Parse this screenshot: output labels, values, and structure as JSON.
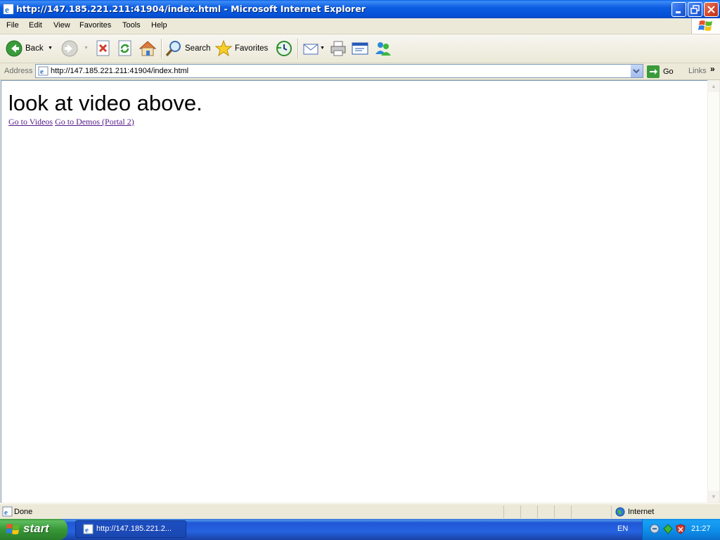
{
  "window": {
    "title": "http://147.185.221.211:41904/index.html - Microsoft Internet Explorer"
  },
  "menu": {
    "items": [
      "File",
      "Edit",
      "View",
      "Favorites",
      "Tools",
      "Help"
    ]
  },
  "toolbar": {
    "back_label": "Back",
    "search_label": "Search",
    "favorites_label": "Favorites"
  },
  "address": {
    "label": "Address",
    "url": "http://147.185.221.211:41904/index.html",
    "go_label": "Go",
    "links_label": "Links"
  },
  "page": {
    "heading": "look at video above.",
    "links": [
      "Go to Videos",
      "Go to Demos (Portal 2)"
    ]
  },
  "status": {
    "text": "Done",
    "zone": "Internet"
  },
  "taskbar": {
    "start_label": "start",
    "task_button": "http://147.185.221.2...",
    "language": "EN",
    "clock": "21:27"
  },
  "icons": {
    "ie": "ie-logo-icon",
    "back": "back-arrow-icon",
    "forward": "forward-arrow-icon",
    "stop": "stop-icon",
    "refresh": "refresh-icon",
    "home": "home-icon",
    "search": "search-icon",
    "favorites": "favorites-star-icon",
    "history": "history-icon",
    "mail": "mail-icon",
    "print": "print-icon",
    "edit": "edit-icon",
    "messenger": "messenger-icon",
    "go": "go-arrow-icon",
    "internet_zone": "globe-icon",
    "windows": "windows-flag-icon"
  },
  "colors": {
    "title_bar": "#0a5fe6",
    "start_button": "#3c9a3c",
    "taskbar": "#2663e0",
    "visited_link": "#551a8b"
  }
}
